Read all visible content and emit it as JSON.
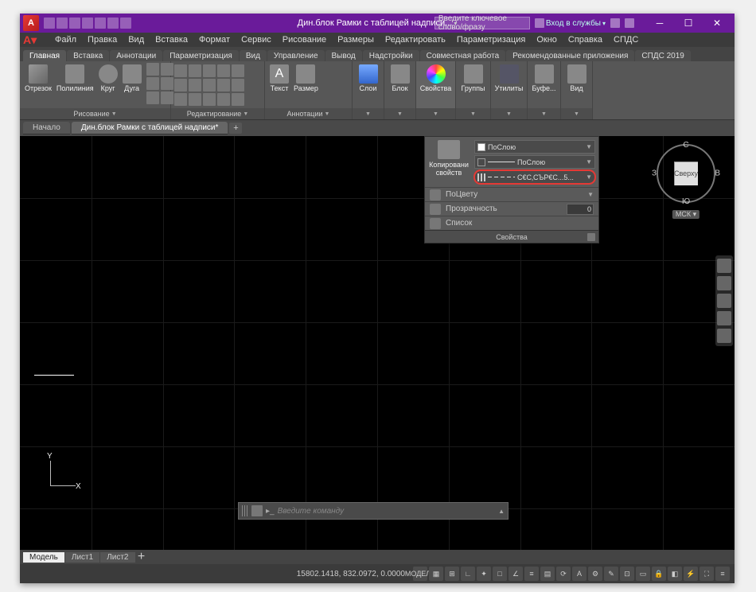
{
  "titlebar": {
    "logo": "A",
    "title": "Дин.блок Рамки с таблицей надписи...",
    "search_placeholder": "Введите ключевое слово/фразу",
    "login": "Вход в службы"
  },
  "menus": [
    "Файл",
    "Правка",
    "Вид",
    "Вставка",
    "Формат",
    "Сервис",
    "Рисование",
    "Размеры",
    "Редактировать",
    "Параметризация",
    "Окно",
    "Справка",
    "СПДС"
  ],
  "tabs": [
    "Главная",
    "Вставка",
    "Аннотации",
    "Параметризация",
    "Вид",
    "Управление",
    "Вывод",
    "Надстройки",
    "Совместная работа",
    "Рекомендованные приложения",
    "СПДС 2019"
  ],
  "ribbon": {
    "draw": {
      "items": [
        "Отрезок",
        "Полилиния",
        "Круг",
        "Дуга"
      ],
      "title": "Рисование"
    },
    "edit": {
      "title": "Редактирование"
    },
    "anno": {
      "items": [
        "Текст",
        "Размер"
      ],
      "title": "Аннотации"
    },
    "layers": {
      "label": "Слои"
    },
    "block": {
      "label": "Блок"
    },
    "props": {
      "label": "Свойства"
    },
    "groups": {
      "label": "Группы"
    },
    "utils": {
      "label": "Утилиты"
    },
    "clip": {
      "label": "Буфе..."
    },
    "view": {
      "label": "Вид"
    }
  },
  "filetabs": {
    "start": "Начало",
    "current": "Дин.блок Рамки с таблицей надписи*"
  },
  "dropdown": {
    "copy_label": "Копировани\nсвойств",
    "color": "ПоСлою",
    "lweight": "ПоСлою",
    "ltype": "С€С‚СЪР€С...5...",
    "bycolor": "ПоЦвету",
    "transp_label": "Прозрачность",
    "transp_val": "0",
    "list": "Список",
    "footer": "Свойства"
  },
  "viewcube": {
    "top": "Сверху",
    "n": "С",
    "s": "Ю",
    "w": "З",
    "e": "В",
    "wcs": "МСК"
  },
  "cmdline": {
    "placeholder": "Введите команду"
  },
  "modeltabs": [
    "Модель",
    "Лист1",
    "Лист2"
  ],
  "statusbar": {
    "coords": "15802.1418, 832.0972, 0.0000",
    "model": "МОДЕЛЬ"
  },
  "ucs": {
    "x": "X",
    "y": "Y"
  }
}
